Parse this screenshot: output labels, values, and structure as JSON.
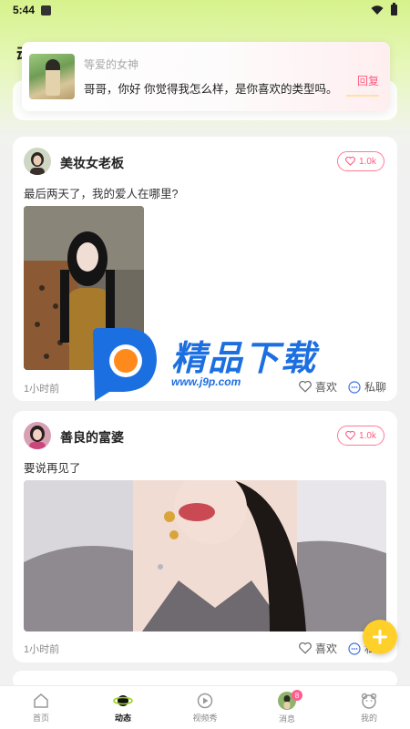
{
  "status_bar": {
    "time": "5:44"
  },
  "header": {
    "title_char": "动"
  },
  "notification": {
    "sender": "等爱的女神",
    "message": "哥哥，你好 你觉得我怎么样，是你喜欢的类型吗。",
    "reply_label": "回复"
  },
  "posts": [
    {
      "author": "美妆女老板",
      "likes": "1.0k",
      "text": "最后两天了，我的爱人在哪里?",
      "time": "1小时前",
      "like_label": "喜欢",
      "chat_label": "私聊"
    },
    {
      "author": "善良的富婆",
      "likes": "1.0k",
      "text": "要说再见了",
      "time": "1小时前",
      "like_label": "喜欢",
      "chat_label": "私聊"
    }
  ],
  "watermark": {
    "title": "精品下载",
    "url": "www.j9p.com"
  },
  "tabbar": {
    "items": [
      {
        "label": "首页"
      },
      {
        "label": "动态"
      },
      {
        "label": "视频秀"
      },
      {
        "label": "消息",
        "badge": "8"
      },
      {
        "label": "我的"
      }
    ]
  },
  "colors": {
    "accent": "#ff5b7f",
    "fab": "#ffd02a",
    "header_green": "#d6f28c"
  }
}
